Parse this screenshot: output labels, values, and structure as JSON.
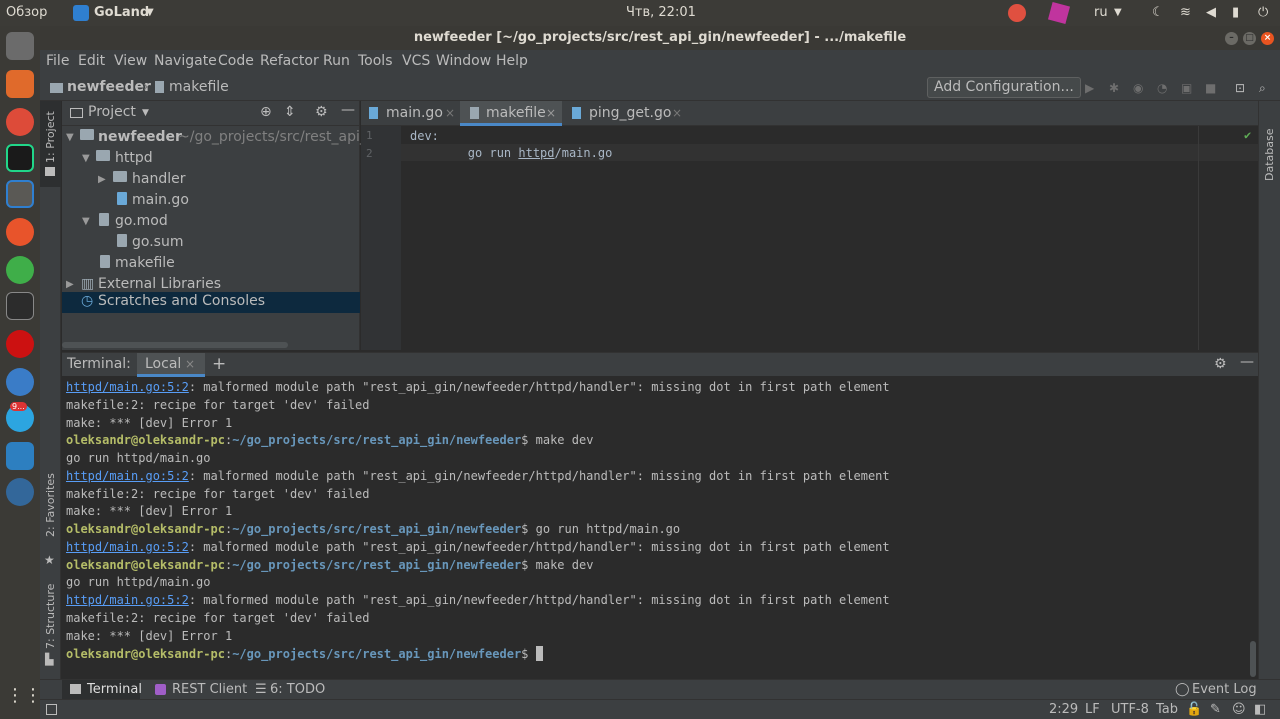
{
  "system_bar": {
    "activities": "Обзор",
    "app_name": "GoLand",
    "clock": "Чтв, 22:01",
    "language": "ru"
  },
  "window": {
    "title": "newfeeder [~/go_projects/src/rest_api_gin/newfeeder] - .../makefile"
  },
  "menu": [
    "File",
    "Edit",
    "View",
    "Navigate",
    "Code",
    "Refactor",
    "Run",
    "Tools",
    "VCS",
    "Window",
    "Help"
  ],
  "nav": {
    "project": "newfeeder",
    "file": "makefile",
    "add_config": "Add Configuration..."
  },
  "side_tools": {
    "project": "1: Project",
    "favorites": "2: Favorites",
    "structure": "7: Structure",
    "database": "Database"
  },
  "project_panel": {
    "title": "Project",
    "root_name": "newfeeder",
    "root_path": "~/go_projects/src/rest_api_g",
    "items": [
      "httpd",
      "handler",
      "main.go",
      "go.mod",
      "go.sum",
      "makefile",
      "External Libraries",
      "Scratches and Consoles"
    ]
  },
  "editor": {
    "tabs": [
      "main.go",
      "makefile",
      "ping_get.go"
    ],
    "line_numbers": [
      "1",
      "2"
    ],
    "line1": "dev:",
    "line2_pre": "        go run ",
    "line2_link": "httpd",
    "line2_post": "/main.go"
  },
  "terminal": {
    "title": "Terminal:",
    "tab": "Local",
    "add": "+",
    "link": "httpd/main.go:5:2",
    "err": ": malformed module path \"rest_api_gin/newfeeder/httpd/handler\": missing dot in first path element",
    "recipe": "makefile:2: recipe for target 'dev' failed",
    "make_err": "make: *** [dev] Error 1",
    "user": "oleksandr@oleksandr-pc",
    "colon": ":",
    "path": "~/go_projects/src/rest_api_gin/newfeeder",
    "cmd_make": "$ make dev",
    "cmd_go": "$ go run httpd/main.go",
    "prompt_end": "$ ",
    "go_run_echo": "go run httpd/main.go"
  },
  "bottom_tools": {
    "terminal": "Terminal",
    "rest_client": "REST Client",
    "todo": "6: TODO",
    "event_log": "Event Log"
  },
  "status": {
    "pos": "2:29",
    "lf": "LF",
    "encoding": "UTF-8",
    "indent": "Tab"
  },
  "badges": {
    "telegram": "9..."
  },
  "colors": {
    "editor_bg": "#2b2b2b",
    "panel_bg": "#3c3f41",
    "selection": "#0d293e",
    "link": "#589df6",
    "prompt_user": "#b5bd68",
    "prompt_path": "#6897bb"
  }
}
